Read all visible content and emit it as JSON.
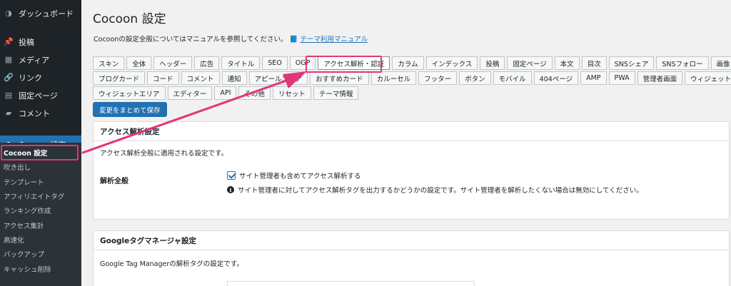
{
  "sidebar": {
    "menu": [
      {
        "icon": "dashboard-icon",
        "glyph": "◑",
        "label": "ダッシュボード",
        "active": false
      },
      {
        "icon": "pin-icon",
        "glyph": "📌",
        "label": "投稿",
        "active": false
      },
      {
        "icon": "media-icon",
        "glyph": "▦",
        "label": "メディア",
        "active": false
      },
      {
        "icon": "link-icon",
        "glyph": "🔗",
        "label": "リンク",
        "active": false
      },
      {
        "icon": "page-icon",
        "glyph": "▤",
        "label": "固定ページ",
        "active": false
      },
      {
        "icon": "comment-icon",
        "glyph": "▰",
        "label": "コメント",
        "active": false
      },
      {
        "icon": "cocoon-icon",
        "glyph": "●",
        "label": "Cocoon 設定",
        "active": true
      }
    ],
    "submenu": [
      "Cocoon 設定",
      "吹き出し",
      "テンプレート",
      "アフィリエイトタグ",
      "ランキング作成",
      "アクセス集計",
      "高速化",
      "バックアップ",
      "キャッシュ削除"
    ]
  },
  "header": {
    "title": "Cocoon 設定",
    "desc": "Cocoonの設定全般についてはマニュアルを参照してください。",
    "manual_link": "テーマ利用マニュアル"
  },
  "tabs": {
    "rows": [
      [
        "スキン",
        "全体",
        "ヘッダー",
        "広告",
        "タイトル",
        "SEO",
        "OGP",
        "アクセス解析・認証",
        "カラム",
        "インデックス",
        "投稿",
        "固定ページ",
        "本文",
        "目次",
        "SNSシェア",
        "SNSフォロー",
        "画像"
      ],
      [
        "ブログカード",
        "コード",
        "コメント",
        "通知",
        "アピールエリア",
        "おすすめカード",
        "カルーセル",
        "フッター",
        "ボタン",
        "モバイル",
        "404ページ",
        "AMP",
        "PWA",
        "管理者画面",
        "ウィジェット"
      ],
      [
        "ウィジェットエリア",
        "エディター",
        "API",
        "その他",
        "リセット",
        "テーマ情報"
      ]
    ],
    "current": "アクセス解析・認証"
  },
  "save_button": "変更をまとめて保存",
  "access": {
    "heading": "アクセス解析設定",
    "desc": "アクセス解析全般に適用される設定です。",
    "field_label": "解析全般",
    "checkbox_label": "サイト管理者も含めてアクセス解析する",
    "checkbox_checked": true,
    "info": "サイト管理者に対してアクセス解析タグを出力するかどうかの設定です。サイト管理者を解析したくない場合は無効にしてください。"
  },
  "gtm": {
    "heading": "Googleタグマネージャ設定",
    "desc": "Google Tag Managerの解析タグの設定です。"
  },
  "colors": {
    "accent": "#2271b1",
    "highlight": "#e3357a",
    "sidebar": "#1d2327"
  }
}
